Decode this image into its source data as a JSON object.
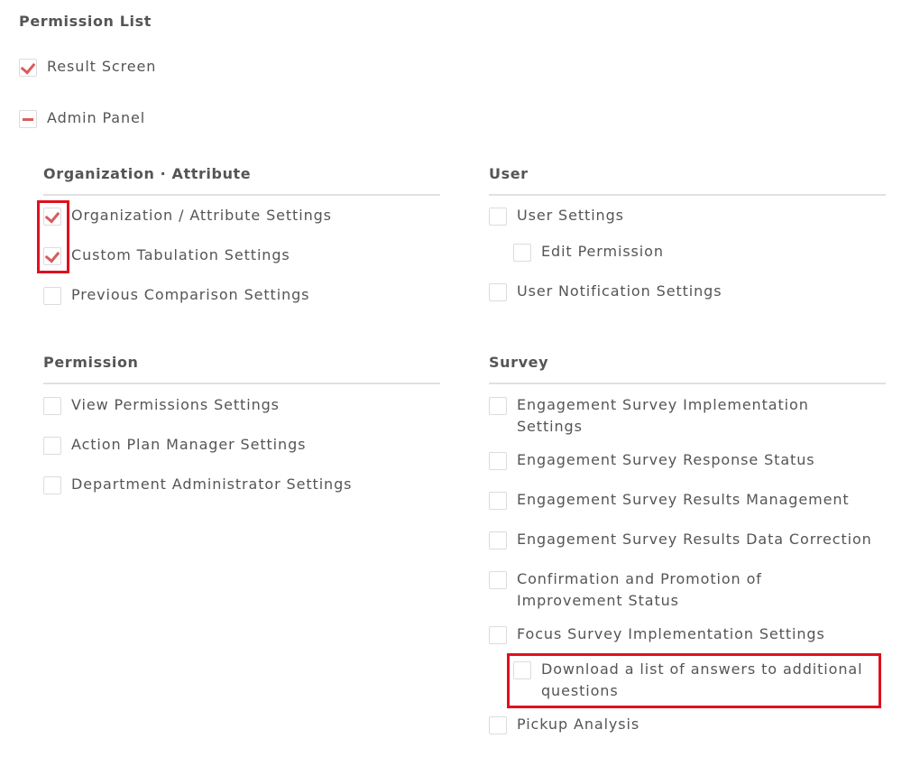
{
  "page_title": "Permission List",
  "top_items": [
    {
      "label": "Result Screen",
      "state": "checked"
    },
    {
      "label": "Admin Panel",
      "state": "partial"
    }
  ],
  "sections": {
    "organization": {
      "title": "Organization · Attribute",
      "items": [
        {
          "label": "Organization / Attribute Settings",
          "state": "checked"
        },
        {
          "label": "Custom Tabulation Settings",
          "state": "checked"
        },
        {
          "label": "Previous Comparison Settings",
          "state": "unchecked"
        }
      ]
    },
    "user": {
      "title": "User",
      "items": [
        {
          "label": "User Settings",
          "state": "unchecked"
        },
        {
          "label": "Edit Permission",
          "state": "unchecked"
        },
        {
          "label": "User Notification Settings",
          "state": "unchecked"
        }
      ]
    },
    "permission": {
      "title": "Permission",
      "items": [
        {
          "label": "View Permissions Settings",
          "state": "unchecked"
        },
        {
          "label": "Action Plan Manager Settings",
          "state": "unchecked"
        },
        {
          "label": "Department Administrator Settings",
          "state": "unchecked"
        }
      ]
    },
    "survey": {
      "title": "Survey",
      "items": [
        {
          "label_line1": "Engagement Survey Implementation",
          "label_line2": "Settings",
          "state": "unchecked"
        },
        {
          "label": "Engagement Survey Response Status",
          "state": "unchecked"
        },
        {
          "label": "Engagement Survey Results Management",
          "state": "unchecked"
        },
        {
          "label": "Engagement Survey Results Data Correction",
          "state": "unchecked"
        },
        {
          "label_line1": "Confirmation and Promotion of",
          "label_line2": "Improvement Status",
          "state": "unchecked"
        },
        {
          "label": "Focus Survey Implementation Settings",
          "state": "unchecked"
        },
        {
          "label_line1": "Download a list of answers to additional",
          "label_line2": "questions",
          "state": "unchecked"
        },
        {
          "label": "Pickup Analysis",
          "state": "unchecked"
        }
      ]
    }
  },
  "highlight_color": "#e0101e",
  "check_color": "#d95c5c"
}
